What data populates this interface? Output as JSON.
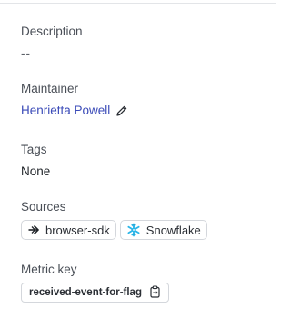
{
  "description": {
    "label": "Description",
    "value": "--"
  },
  "maintainer": {
    "label": "Maintainer",
    "name": "Henrietta Powell",
    "edit_icon": "pencil-icon"
  },
  "tags": {
    "label": "Tags",
    "value": "None"
  },
  "sources": {
    "label": "Sources",
    "items": [
      {
        "label": "browser-sdk",
        "icon": "arrow-right-icon"
      },
      {
        "label": "Snowflake",
        "icon": "snowflake-icon",
        "icon_color": "#29b5e8"
      }
    ]
  },
  "metric_key": {
    "label": "Metric key",
    "value": "received-event-for-flag",
    "copy_icon": "clipboard-copy-icon"
  },
  "colors": {
    "link": "#3b4bb8",
    "border": "#d4d7dc",
    "snowflake": "#29b5e8"
  }
}
